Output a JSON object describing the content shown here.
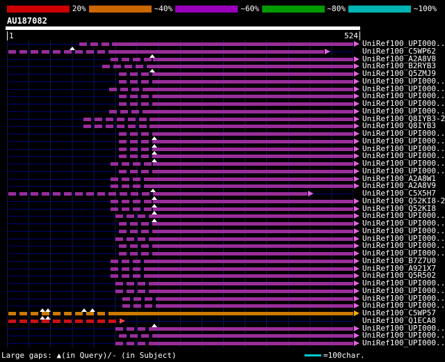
{
  "chart_data": {
    "type": "bar",
    "orientation": "horizontal-alignment-map",
    "title": "BLAST hit graphical overview",
    "query": {
      "name": "AU187082",
      "start_label": "1",
      "end_label": "524",
      "length": 524
    },
    "identity_scale": {
      "segments": [
        {
          "label": "20%",
          "color": "#cc0000"
        },
        {
          "label": "~40%",
          "color": "#cc6600"
        },
        {
          "label": "~60%",
          "color": "#9900bb"
        },
        {
          "label": "~80%",
          "color": "#009900"
        },
        {
          "label": "~100%",
          "color": "#00b3b3"
        }
      ]
    },
    "legend": {
      "large_gaps": "Large gaps: ▲(in Query)/- (in Subject)",
      "scale_text": "=100char.",
      "scale_line_color": "#00cccc"
    },
    "colors": {
      "purple": {
        "bar": "#992d99",
        "arrow": "#e463e4"
      },
      "orange": {
        "bar": "#cc7a00",
        "arrow": "#ffb300"
      },
      "red": {
        "bar": "#cc1111",
        "arrow": "#ff4444"
      },
      "gap_marker": "#ffffff",
      "track": "#000077",
      "grid": "#0c1c50"
    },
    "rows": [
      {
        "label": "UniRef100_UPI000..",
        "color": "purple",
        "start": 110,
        "solid_from": 160,
        "end": 524,
        "gaps": []
      },
      {
        "label": "UniRef100_C5WP62",
        "color": "purple",
        "start": 3,
        "solid_from": 160,
        "end": 480,
        "gaps": [
          100
        ]
      },
      {
        "label": "UniRef100_A2A8V8",
        "color": "purple",
        "start": 158,
        "solid_from": 222,
        "end": 524,
        "gaps": [
          220
        ]
      },
      {
        "label": "UniRef100_B2RYB3",
        "color": "purple",
        "start": 145,
        "solid_from": 222,
        "end": 524,
        "gaps": []
      },
      {
        "label": "UniRef100_Q5ZMJ9",
        "color": "purple",
        "start": 170,
        "solid_from": 222,
        "end": 524,
        "gaps": [
          220
        ]
      },
      {
        "label": "UniRef100_UPI000..",
        "color": "purple",
        "start": 170,
        "solid_from": 222,
        "end": 524,
        "gaps": []
      },
      {
        "label": "UniRef100_UPI000..",
        "color": "purple",
        "start": 155,
        "solid_from": 216,
        "end": 524,
        "gaps": []
      },
      {
        "label": "UniRef100_UPI000..",
        "color": "purple",
        "start": 170,
        "solid_from": 222,
        "end": 524,
        "gaps": []
      },
      {
        "label": "UniRef100_UPI000..",
        "color": "purple",
        "start": 170,
        "solid_from": 222,
        "end": 524,
        "gaps": []
      },
      {
        "label": "UniRef100_UPI000..",
        "color": "purple",
        "start": 155,
        "solid_from": 216,
        "end": 524,
        "gaps": []
      },
      {
        "label": "UniRef100_Q8IYB3-2",
        "color": "purple",
        "start": 116,
        "solid_from": 216,
        "end": 524,
        "gaps": []
      },
      {
        "label": "UniRef100_Q8IYB3",
        "color": "purple",
        "start": 116,
        "solid_from": 216,
        "end": 524,
        "gaps": []
      },
      {
        "label": "UniRef100_UPI000..",
        "color": "purple",
        "start": 170,
        "solid_from": 222,
        "end": 524,
        "gaps": []
      },
      {
        "label": "UniRef100_UPI000..",
        "color": "purple",
        "start": 170,
        "solid_from": 222,
        "end": 524,
        "gaps": [
          224
        ]
      },
      {
        "label": "UniRef100_UPI000..",
        "color": "purple",
        "start": 170,
        "solid_from": 222,
        "end": 524,
        "gaps": [
          224
        ]
      },
      {
        "label": "UniRef100_UPI000..",
        "color": "purple",
        "start": 170,
        "solid_from": 222,
        "end": 524,
        "gaps": [
          224
        ]
      },
      {
        "label": "UniRef100_UPI000..",
        "color": "purple",
        "start": 158,
        "solid_from": 222,
        "end": 524,
        "gaps": [
          224
        ]
      },
      {
        "label": "UniRef100_UPI000..",
        "color": "purple",
        "start": 170,
        "solid_from": 222,
        "end": 524,
        "gaps": []
      },
      {
        "label": "UniRef100_A2A8W1",
        "color": "purple",
        "start": 158,
        "solid_from": 216,
        "end": 524,
        "gaps": []
      },
      {
        "label": "UniRef100_A2A8V9",
        "color": "purple",
        "start": 158,
        "solid_from": 216,
        "end": 524,
        "gaps": []
      },
      {
        "label": "UniRef100_C5X5H7",
        "color": "purple",
        "start": 3,
        "solid_from": 222,
        "end": 455,
        "gaps": [
          222
        ]
      },
      {
        "label": "UniRef100_Q52KI8-2",
        "color": "purple",
        "start": 158,
        "solid_from": 222,
        "end": 524,
        "gaps": [
          224
        ]
      },
      {
        "label": "UniRef100_Q52KI8",
        "color": "purple",
        "start": 158,
        "solid_from": 222,
        "end": 524,
        "gaps": [
          224
        ]
      },
      {
        "label": "UniRef100_UPI000..",
        "color": "purple",
        "start": 165,
        "solid_from": 222,
        "end": 524,
        "gaps": [
          224
        ]
      },
      {
        "label": "UniRef100_UPI000..",
        "color": "purple",
        "start": 170,
        "solid_from": 222,
        "end": 524,
        "gaps": [
          224
        ]
      },
      {
        "label": "UniRef100_UPI000..",
        "color": "purple",
        "start": 170,
        "solid_from": 222,
        "end": 524,
        "gaps": []
      },
      {
        "label": "UniRef100_UPI000..",
        "color": "purple",
        "start": 165,
        "solid_from": 222,
        "end": 524,
        "gaps": []
      },
      {
        "label": "UniRef100_UPI000..",
        "color": "purple",
        "start": 170,
        "solid_from": 222,
        "end": 524,
        "gaps": []
      },
      {
        "label": "UniRef100_UPI000..",
        "color": "purple",
        "start": 170,
        "solid_from": 222,
        "end": 524,
        "gaps": []
      },
      {
        "label": "UniRef100_B7Z7U0",
        "color": "purple",
        "start": 158,
        "solid_from": 216,
        "end": 524,
        "gaps": []
      },
      {
        "label": "UniRef100_A921X7",
        "color": "purple",
        "start": 158,
        "solid_from": 216,
        "end": 524,
        "gaps": []
      },
      {
        "label": "UniRef100_Q5R502",
        "color": "purple",
        "start": 158,
        "solid_from": 216,
        "end": 524,
        "gaps": []
      },
      {
        "label": "UniRef100_UPI000..",
        "color": "purple",
        "start": 165,
        "solid_from": 222,
        "end": 524,
        "gaps": []
      },
      {
        "label": "UniRef100_UPI000..",
        "color": "purple",
        "start": 165,
        "solid_from": 222,
        "end": 524,
        "gaps": []
      },
      {
        "label": "UniRef100_UPI000..",
        "color": "purple",
        "start": 175,
        "solid_from": 227,
        "end": 524,
        "gaps": []
      },
      {
        "label": "UniRef100_UPI000..",
        "color": "purple",
        "start": 175,
        "solid_from": 227,
        "end": 524,
        "gaps": []
      },
      {
        "label": "UniRef100_C5WP57",
        "color": "orange",
        "start": 3,
        "solid_from": 160,
        "end": 524,
        "gaps": [
          55,
          63,
          118,
          130
        ]
      },
      {
        "label": "UniRef100_Q1ECA8",
        "color": "red",
        "start": 3,
        "solid_from": 170,
        "end": 170,
        "gaps": [
          55,
          63
        ]
      },
      {
        "label": "UniRef100_UPI000..",
        "color": "purple",
        "start": 165,
        "solid_from": 222,
        "end": 524,
        "gaps": [
          224
        ]
      },
      {
        "label": "UniRef100_UPI000..",
        "color": "purple",
        "start": 170,
        "solid_from": 222,
        "end": 524,
        "gaps": []
      },
      {
        "label": "UniRef100_UPI000..",
        "color": "purple",
        "start": 165,
        "solid_from": 222,
        "end": 524,
        "gaps": []
      }
    ]
  }
}
